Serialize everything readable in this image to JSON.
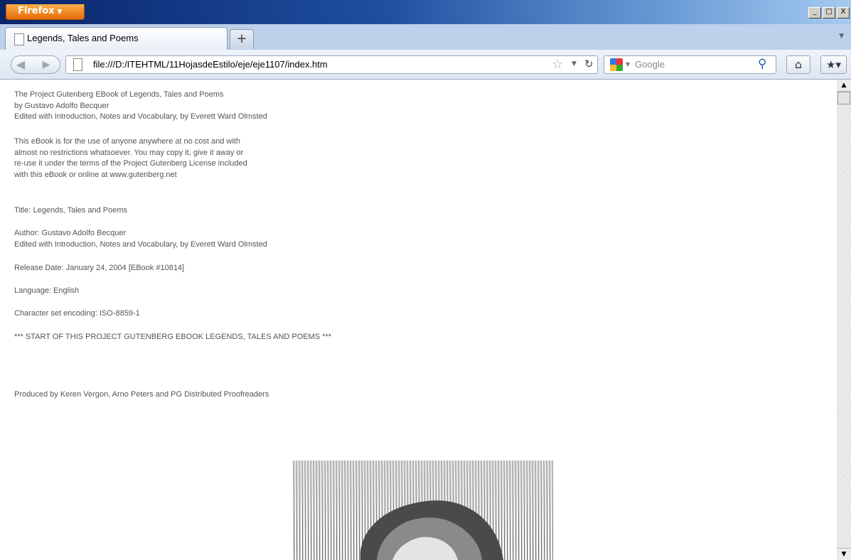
{
  "window": {
    "app_button": "Firefox",
    "controls": {
      "minimize": "_",
      "maximize": "□",
      "close": "X"
    }
  },
  "tabs": [
    {
      "label": "Legends, Tales and Poems",
      "active": true
    }
  ],
  "new_tab_label": "+",
  "navbar": {
    "url": "file:///D:/ITEHTML/11HojasdeEstilo/eje/eje1107/index.htm",
    "search_placeholder": "Google",
    "icons": [
      "back-arrow-icon",
      "forward-arrow-icon",
      "page-icon",
      "bookmark-star-icon",
      "reload-icon",
      "google-icon",
      "search-magnifier-icon",
      "home-icon",
      "bookmarks-icon"
    ]
  },
  "page": {
    "header_lines": [
      "The Project Gutenberg EBook of Legends, Tales and Poems",
      "by Gustavo Adolfo Becquer",
      "Edited with Introduction, Notes and Vocabulary, by Everett Ward Olmsted"
    ],
    "license_lines": [
      "This eBook is for the use of anyone anywhere at no cost and with",
      "almost no restrictions whatsoever.  You may copy it, give it away or",
      "re-use it under the terms of the Project Gutenberg License included",
      "with this eBook or online at www.gutenberg.net"
    ],
    "title_line": "Title: Legends, Tales and Poems",
    "author_lines": [
      "Author: Gustavo Adolfo Becquer",
      "Edited with Introduction, Notes and Vocabulary, by Everett Ward Olmsted"
    ],
    "release_line": "Release Date: January 24, 2004 [EBook #10814]",
    "language_line": "Language: English",
    "charset_line": "Character set encoding: ISO-8859-1",
    "start_line": "*** START OF THIS PROJECT GUTENBERG EBOOK LEGENDS, TALES AND POEMS ***",
    "produced_line": "Produced by Keren Vergon, Arno Peters and PG Distributed Proofreaders"
  },
  "colors": {
    "titlebar_start": "#0a246a",
    "firefox_orange": "#e66a08",
    "text_gray": "#555555"
  }
}
